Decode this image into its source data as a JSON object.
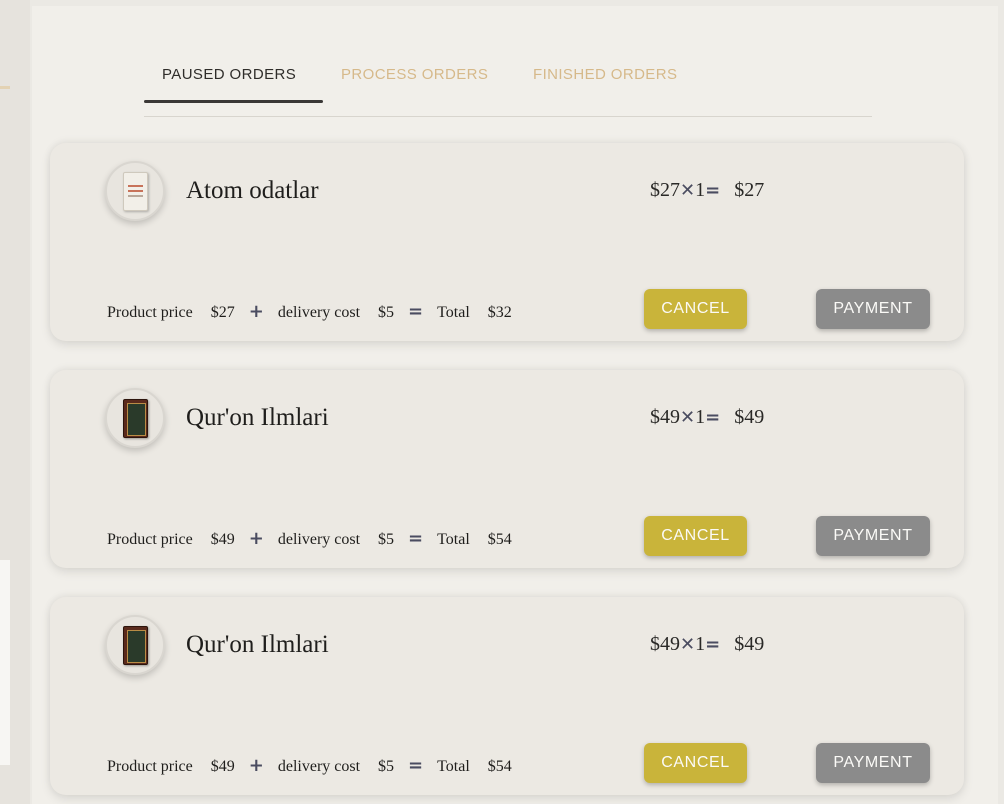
{
  "tabs": [
    {
      "label": "PAUSED ORDERS",
      "active": true
    },
    {
      "label": "PROCESS ORDERS",
      "active": false
    },
    {
      "label": "FINISHED ORDERS",
      "active": false
    }
  ],
  "colors": {
    "accent_tab": "#3a3836",
    "inactive_tab": "#d6b98a",
    "cancel_button": "#c9b43a",
    "payment_button": "#8b8b8b",
    "card_bg": "#ece9e3"
  },
  "symbols": {
    "times": "✕",
    "equals": "=",
    "plus": "+"
  },
  "orders": [
    {
      "title": "Atom odatlar",
      "cover_icon": "book-cover-light",
      "unit_price": "$27",
      "quantity": "1",
      "line_total": "$27",
      "product_price_label": "Product price",
      "product_price": "$27",
      "delivery_label": "delivery cost",
      "delivery_cost": "$5",
      "total_label": "Total",
      "total": "$32",
      "cancel_label": "CANCEL",
      "payment_label": "PAYMENT"
    },
    {
      "title": "Qur'on Ilmlari",
      "cover_icon": "book-cover-dark",
      "unit_price": "$49",
      "quantity": "1",
      "line_total": "$49",
      "product_price_label": "Product price",
      "product_price": "$49",
      "delivery_label": "delivery cost",
      "delivery_cost": "$5",
      "total_label": "Total",
      "total": "$54",
      "cancel_label": "CANCEL",
      "payment_label": "PAYMENT"
    },
    {
      "title": "Qur'on Ilmlari",
      "cover_icon": "book-cover-dark",
      "unit_price": "$49",
      "quantity": "1",
      "line_total": "$49",
      "product_price_label": "Product price",
      "product_price": "$49",
      "delivery_label": "delivery cost",
      "delivery_cost": "$5",
      "total_label": "Total",
      "total": "$54",
      "cancel_label": "CANCEL",
      "payment_label": "PAYMENT"
    }
  ]
}
